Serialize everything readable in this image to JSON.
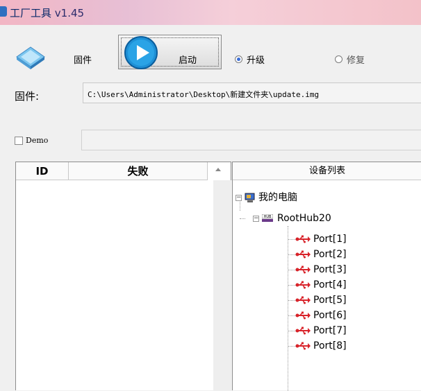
{
  "window": {
    "title": "工厂工具",
    "version": "v1.45"
  },
  "toolbar": {
    "firmware_label": "固件",
    "start_label": "启动",
    "upgrade_label": "升级",
    "repair_label": "修复",
    "selected_mode": "upgrade"
  },
  "firmware_path": {
    "label": "固件:",
    "value": "C:\\Users\\Administrator\\Desktop\\新建文件夹\\update.img"
  },
  "demo": {
    "label": "Demo",
    "checked": false,
    "value": ""
  },
  "result_list": {
    "columns": [
      "ID",
      "失败"
    ],
    "rows": []
  },
  "device_tree": {
    "header": "设备列表",
    "root": "我的电脑",
    "hub": "RootHub20",
    "ports": [
      "Port[1]",
      "Port[2]",
      "Port[3]",
      "Port[4]",
      "Port[5]",
      "Port[6]",
      "Port[7]",
      "Port[8]"
    ]
  },
  "colors": {
    "titlebar": "#f2b6c4",
    "play_button": "#1e90d6",
    "usb_icon": "#d8232a"
  }
}
